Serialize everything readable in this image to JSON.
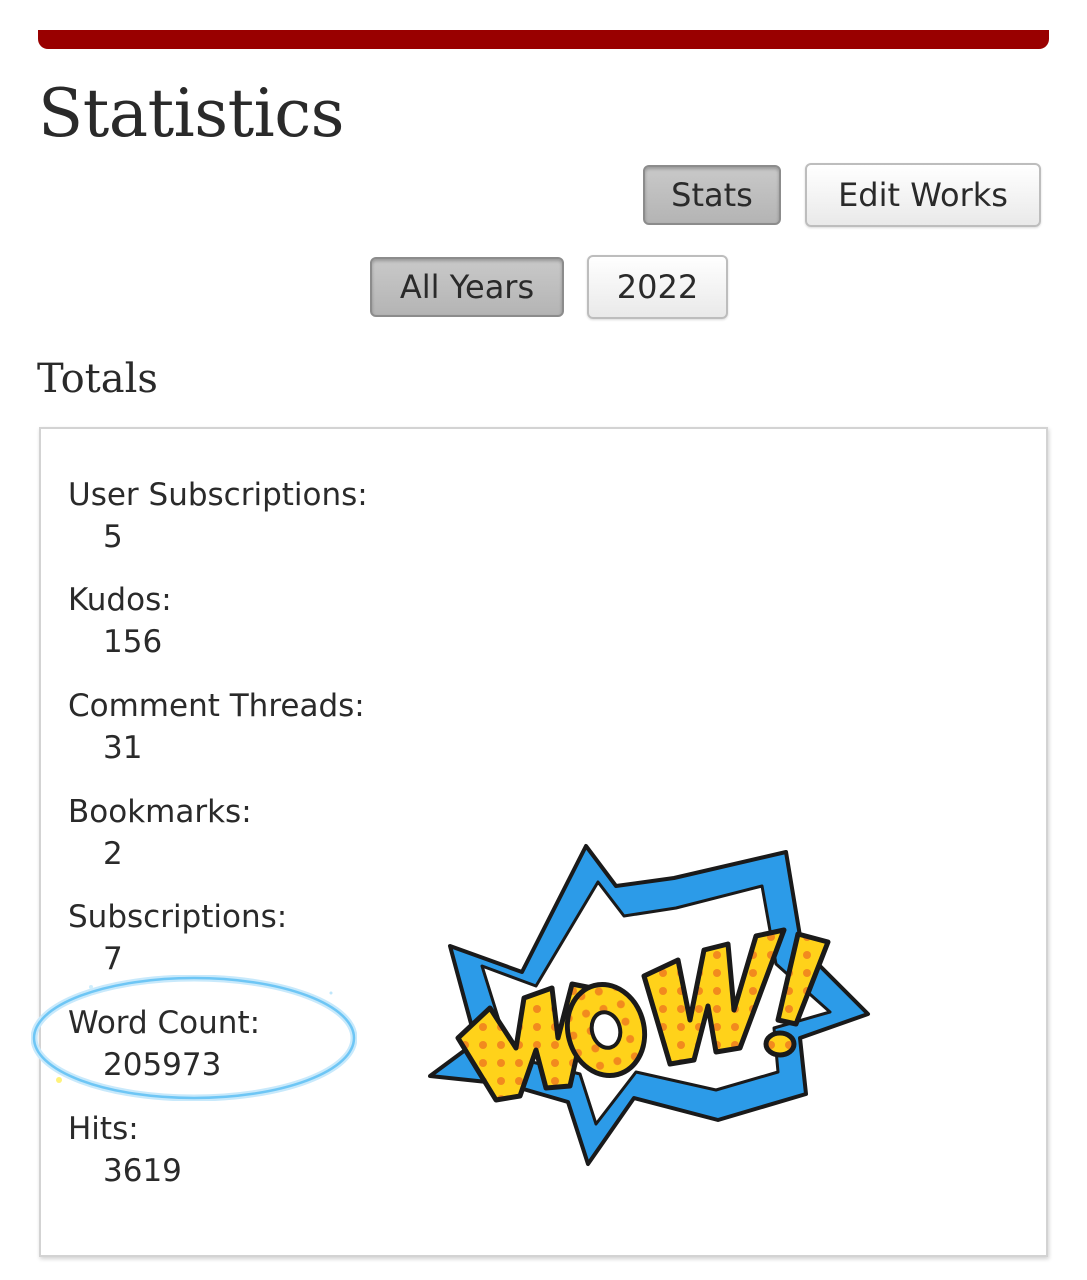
{
  "header": {
    "title": "Statistics"
  },
  "view_toggle": {
    "stats_label": "Stats",
    "edit_works_label": "Edit Works"
  },
  "year_filter": {
    "all_years_label": "All Years",
    "year_2022_label": "2022"
  },
  "totals": {
    "heading": "Totals",
    "items": [
      {
        "label": "User Subscriptions:",
        "value": "5"
      },
      {
        "label": "Kudos:",
        "value": "156"
      },
      {
        "label": "Comment Threads:",
        "value": "31"
      },
      {
        "label": "Bookmarks:",
        "value": "2"
      },
      {
        "label": "Subscriptions:",
        "value": "7"
      },
      {
        "label": "Word Count:",
        "value": "205973"
      },
      {
        "label": "Hits:",
        "value": "3619"
      }
    ]
  },
  "sticker": {
    "text": "WOW!",
    "icon": "wow-burst-sticker"
  },
  "colors": {
    "brand_bar": "#990000",
    "circle_highlight": "#6ec6f5",
    "sticker_blue": "#2c9be8",
    "sticker_yellow": "#ffd21a",
    "sticker_dots": "#f28a1e"
  }
}
